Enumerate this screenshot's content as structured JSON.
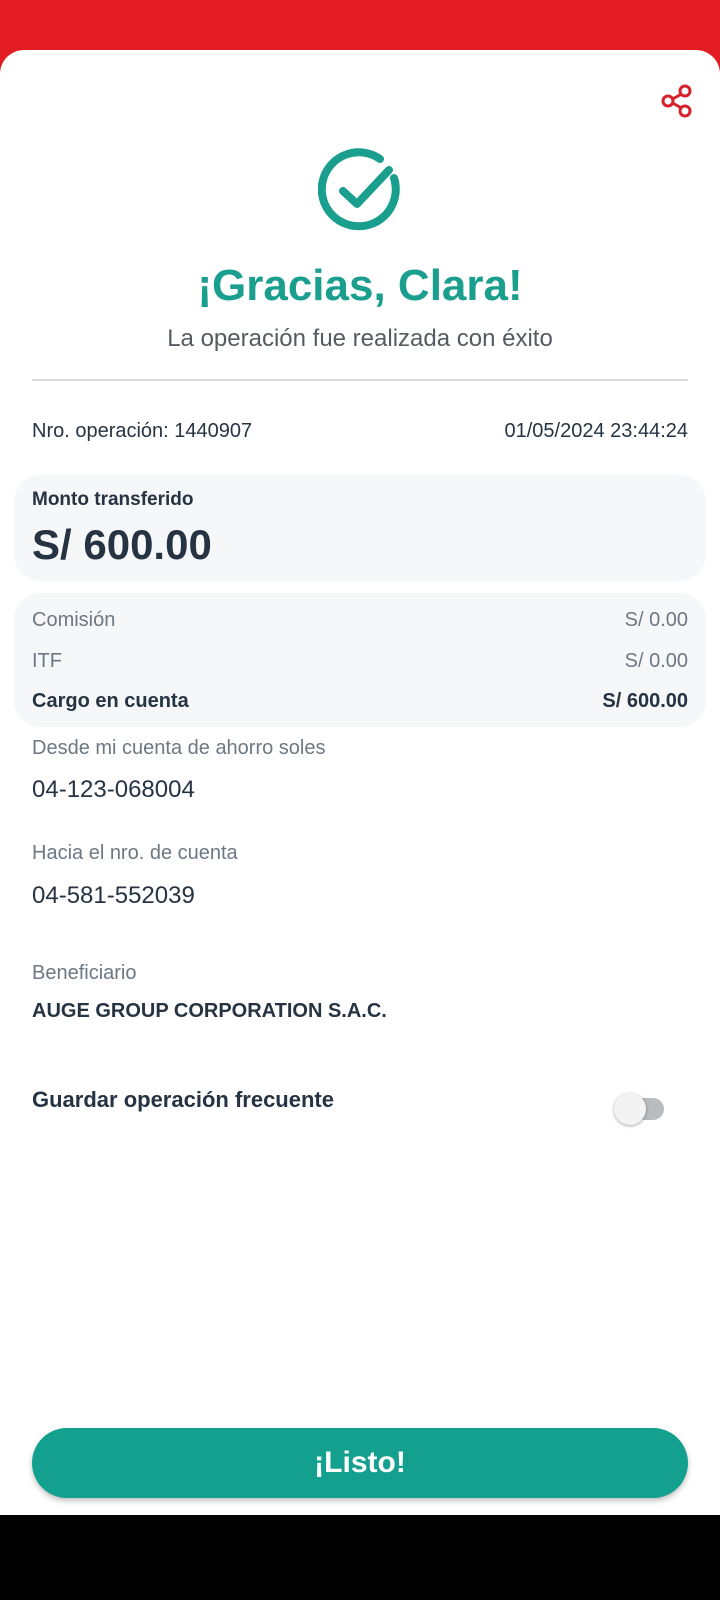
{
  "header": {
    "share_icon": "share-icon",
    "success_icon": "check-circle-icon",
    "title": "¡Gracias, Clara!",
    "subtitle": "La operación fue realizada con éxito"
  },
  "operation": {
    "number_label": "Nro. operación: 1440907",
    "datetime": "01/05/2024 23:44:24"
  },
  "amount": {
    "label": "Monto transferido",
    "value": "S/ 600.00"
  },
  "fees": {
    "commission_label": "Comisión",
    "commission_value": "S/ 0.00",
    "itf_label": "ITF",
    "itf_value": "S/ 0.00",
    "charge_label": "Cargo en cuenta",
    "charge_value": "S/ 600.00"
  },
  "from_account": {
    "label": "Desde mi cuenta de ahorro soles",
    "value": "04-123-068004"
  },
  "to_account": {
    "label": "Hacia el nro. de cuenta",
    "value": "04-581-552039"
  },
  "beneficiary": {
    "label": "Beneficiario",
    "value": "AUGE GROUP CORPORATION S.A.C."
  },
  "save_frequent": {
    "label": "Guardar operación frecuente",
    "enabled": false
  },
  "done_button": {
    "label": "¡Listo!"
  },
  "colors": {
    "brand_red": "#e31b23",
    "accent_teal": "#1a9e8d",
    "button_teal": "#14a08e",
    "text_dark": "#263342"
  }
}
